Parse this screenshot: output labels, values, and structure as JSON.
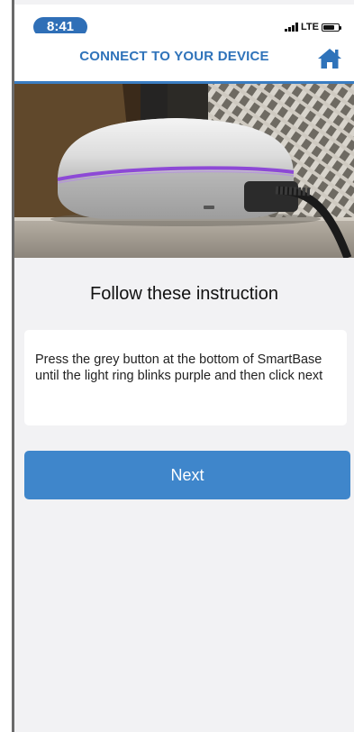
{
  "status_bar": {
    "time": "8:41",
    "network": "LTE",
    "icons": [
      "signal-icon",
      "battery-icon"
    ]
  },
  "header": {
    "title": "CONNECT TO YOUR DEVICE",
    "home_icon": "home-icon"
  },
  "hero": {
    "description_icon": "device-photo"
  },
  "content": {
    "title": "Follow these instruction",
    "instruction": "Press the grey button at the bottom of SmartBase until the light ring blinks purple and then click next"
  },
  "actions": {
    "next_label": "Next"
  },
  "colors": {
    "accent": "#2f73ba",
    "button": "#3f86cb",
    "time_pill": "#2f6fb7",
    "background": "#f2f2f4",
    "light_ring": "#8d49d6"
  }
}
